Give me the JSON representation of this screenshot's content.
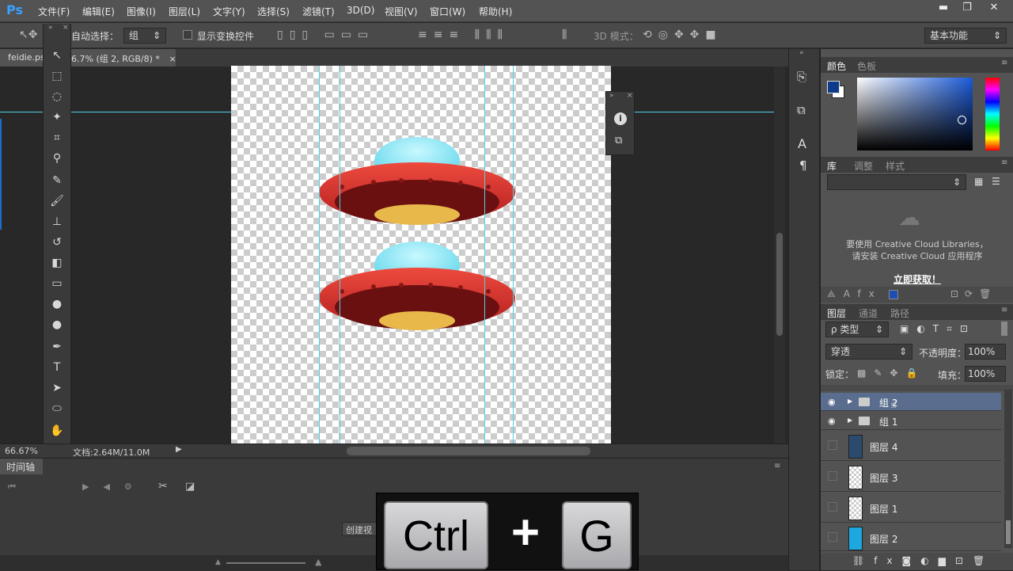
{
  "app": {
    "logo": "Ps"
  },
  "menu": [
    "文件(F)",
    "编辑(E)",
    "图像(I)",
    "图层(L)",
    "文字(Y)",
    "选择(S)",
    "滤镜(T)",
    "3D(D)",
    "视图(V)",
    "窗口(W)",
    "帮助(H)"
  ],
  "window_controls": {
    "minimize": "▬",
    "restore": "❐",
    "close": "✕"
  },
  "options": {
    "auto_select_label": "自动选择：",
    "auto_select_value": "组",
    "show_transform_label": "显示变换控件",
    "three_d_mode_label": "3D 模式：",
    "workspace": "基本功能"
  },
  "document_tab": {
    "prefix": "feidie.ps",
    "suffix": "6.7% (组 2, RGB/8) *",
    "close": "×"
  },
  "status": {
    "zoom": "66.67%",
    "doc_info": "文档:2.64M/11.0M"
  },
  "timeline": {
    "title": "时间轴",
    "create_button": "创建视"
  },
  "panels": {
    "color_tabs": [
      "颜色",
      "色板"
    ],
    "library_tabs": [
      "库",
      "调整",
      "样式"
    ],
    "library_message_1": "要使用 Creative Cloud Libraries，",
    "library_message_2": "请安装 Creative Cloud 应用程序",
    "library_link": "立即获取！",
    "layer_tabs": [
      "图层",
      "通道",
      "路径"
    ],
    "filter_kind": "ρ 类型",
    "blend_mode": "穿透",
    "opacity_label": "不透明度：",
    "opacity_value": "100%",
    "lock_label": "锁定：",
    "fill_label": "填充：",
    "fill_value": "100%"
  },
  "layers": [
    {
      "name": "组 2",
      "type": "group",
      "visible": true,
      "selected": true
    },
    {
      "name": "组 1",
      "type": "group",
      "visible": true,
      "selected": false
    },
    {
      "name": "图层 4",
      "type": "layer",
      "visible": false,
      "selected": false
    },
    {
      "name": "图层 3",
      "type": "layer",
      "visible": false,
      "selected": false
    },
    {
      "name": "图层 1",
      "type": "layer",
      "visible": false,
      "selected": false
    },
    {
      "name": "图层 2",
      "type": "layer",
      "visible": false,
      "selected": false
    }
  ],
  "keys": {
    "ctrl": "Ctrl",
    "plus": "+",
    "g": "G"
  },
  "colors": {
    "foreground": "#0e3a8a",
    "background": "#ffffff",
    "guide": "#4fd1e0",
    "ufo_red": "#d42a2a",
    "ufo_dome": "#7fe3f2",
    "ufo_light": "#e8b84a",
    "layer2_thumb": "#1ea8e0"
  }
}
